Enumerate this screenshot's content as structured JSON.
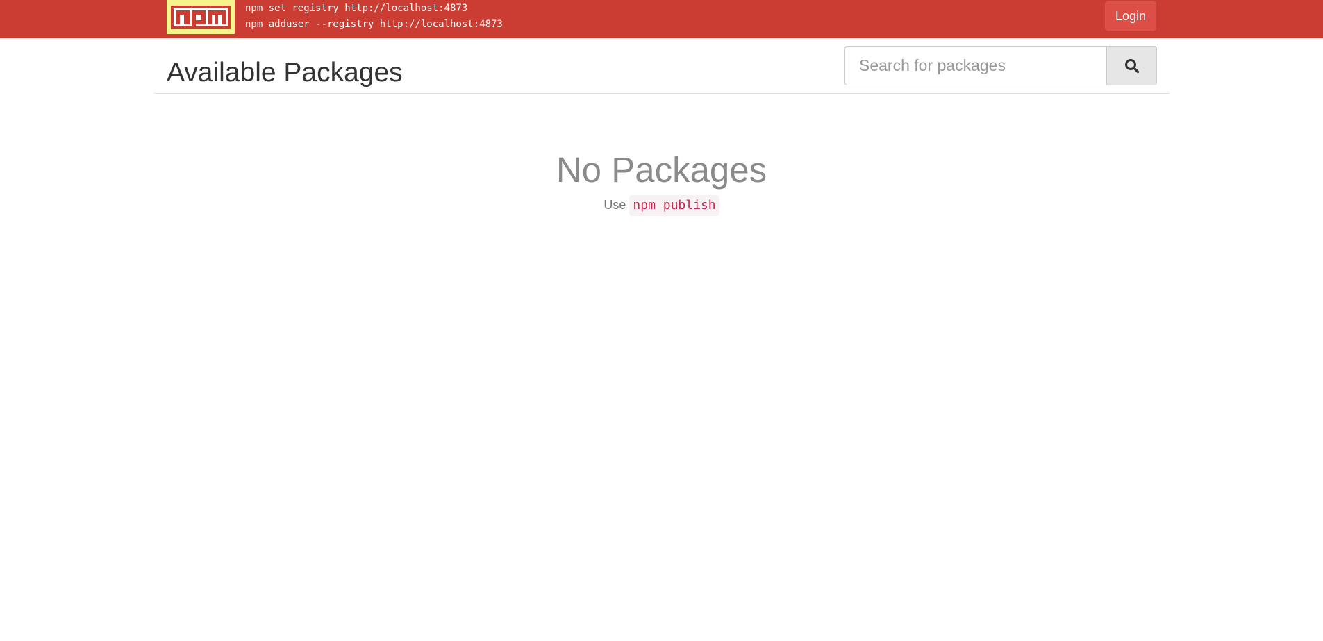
{
  "topbar": {
    "logo_text": "npm",
    "setup_lines": [
      "npm set registry http://localhost:4873",
      "npm adduser --registry http://localhost:4873"
    ],
    "login_label": "Login",
    "bar_color": "#cb3d33",
    "logo_bg": "#f6f38a"
  },
  "header": {
    "title": "Available Packages",
    "search": {
      "placeholder": "Search for packages",
      "value": "",
      "button_icon": "search-icon"
    }
  },
  "empty_state": {
    "title": "No Packages",
    "hint_prefix": "Use",
    "hint_command": "npm publish"
  }
}
